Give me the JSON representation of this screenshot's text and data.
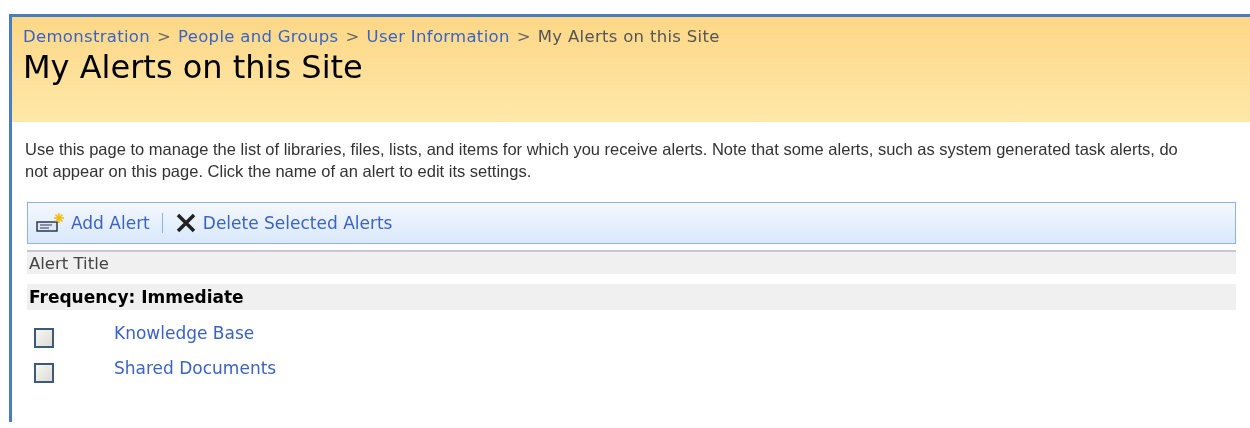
{
  "breadcrumb": [
    {
      "label": "Demonstration",
      "current": false
    },
    {
      "label": "People and Groups",
      "current": false
    },
    {
      "label": "User Information",
      "current": false
    },
    {
      "label": "My Alerts on this Site",
      "current": true
    }
  ],
  "separator": ">",
  "title": "My Alerts on this Site",
  "description": "Use this page to manage the list of libraries, files, lists, and items for which you receive alerts. Note that some alerts, such as system generated task alerts, do not appear on this page. Click the name of an alert to edit its settings.",
  "toolbar": [
    {
      "kind": "add",
      "label": "Add Alert"
    },
    {
      "kind": "delete",
      "label": "Delete Selected Alerts"
    }
  ],
  "table": {
    "columns": [
      "Alert Title"
    ],
    "groups": [
      {
        "label": "Frequency: Immediate",
        "rows": [
          {
            "title": "Knowledge Base",
            "checked": false
          },
          {
            "title": "Shared Documents",
            "checked": false
          }
        ]
      }
    ]
  }
}
